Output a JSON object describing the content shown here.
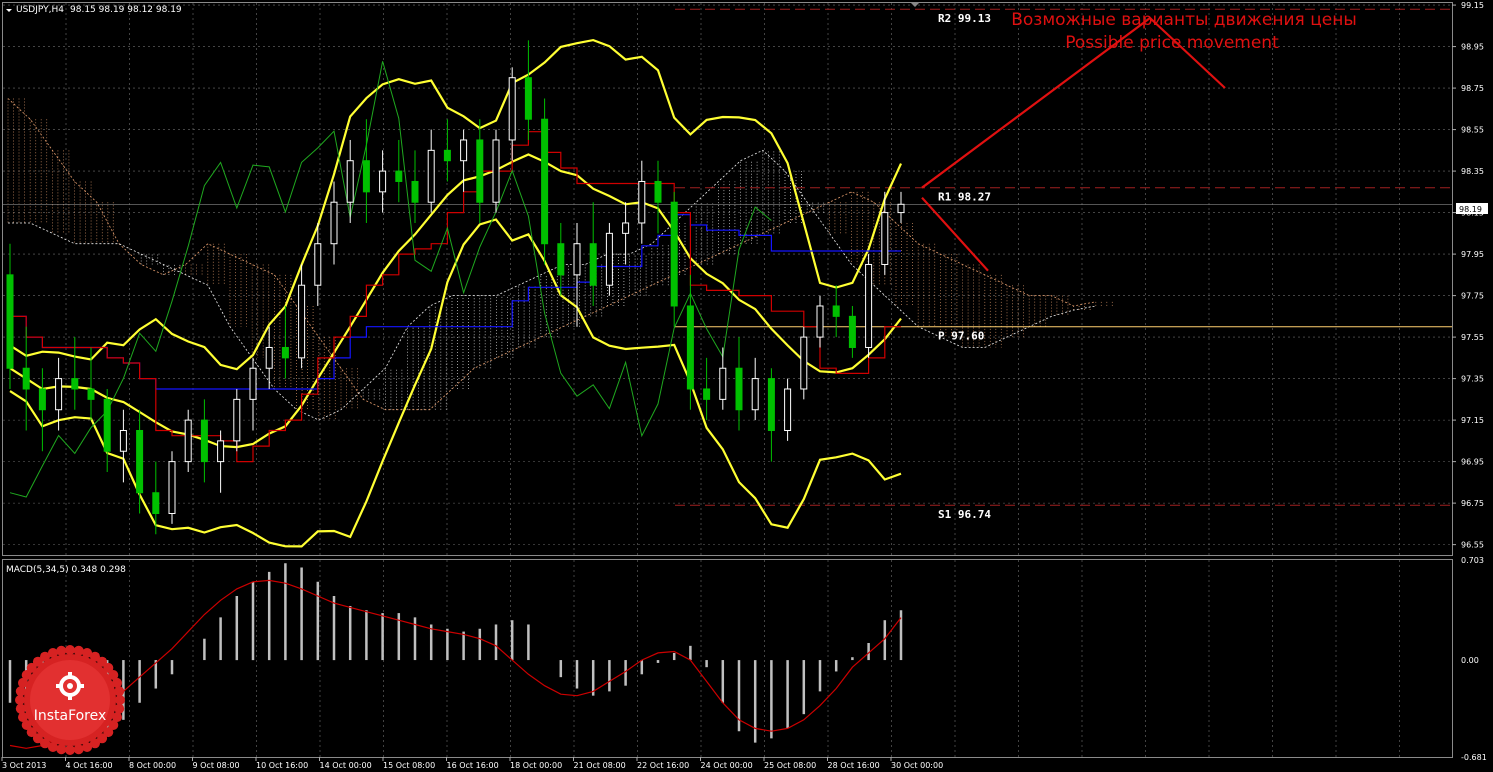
{
  "header": {
    "symbol": "USDJPY,H4",
    "ohlc": "98.15 98.19 98.12 98.19"
  },
  "macd_header": "MACD(5,34,5) 0.348 0.298",
  "annotation": {
    "ru": "Возможные варианты движения цены",
    "en": "Possible price movement"
  },
  "logo_text": "InstaForex",
  "colors": {
    "background": "#000000",
    "grid": "#6e6e6e",
    "bull": "#ffffff",
    "bear": "#00c000",
    "tenkan": "#d00000",
    "kijun": "#1414ff",
    "chikou": "#1fa81f",
    "bollinger": "#ffff33",
    "cloud_a": "#e8a070",
    "cloud_b": "#f0f0f0",
    "pivot": "#ffd070",
    "levels": "#a02020",
    "annotation": "#e01010",
    "macd_hist": "#c0c0c0",
    "macd_signal": "#cc0000"
  },
  "chart_data": {
    "type": "candlestick",
    "symbol": "USDJPY",
    "timeframe": "H4",
    "ylim": [
      96.5,
      99.16
    ],
    "y_ticks": [
      "99.15",
      "98.95",
      "98.75",
      "98.55",
      "98.35",
      "98.15",
      "97.95",
      "97.75",
      "97.55",
      "97.35",
      "97.15",
      "96.95",
      "96.75",
      "96.55"
    ],
    "current_price": "98.19",
    "x_ticks": [
      "3 Oct 2013",
      "4 Oct 16:00",
      "8 Oct 00:00",
      "9 Oct 08:00",
      "10 Oct 16:00",
      "14 Oct 00:00",
      "15 Oct 08:00",
      "16 Oct 16:00",
      "18 Oct 00:00",
      "21 Oct 08:00",
      "22 Oct 16:00",
      "24 Oct 00:00",
      "25 Oct 08:00",
      "28 Oct 16:00",
      "30 Oct 00:00"
    ],
    "levels": [
      {
        "label": "R2 99.13",
        "value": 99.13
      },
      {
        "label": "R1 98.27",
        "value": 98.27
      },
      {
        "label": "P 97.60",
        "value": 97.6
      },
      {
        "label": "S1 96.74",
        "value": 96.74
      }
    ],
    "candles": [
      {
        "o": 97.85,
        "h": 98.0,
        "l": 97.3,
        "c": 97.4
      },
      {
        "o": 97.4,
        "h": 97.6,
        "l": 97.1,
        "c": 97.3
      },
      {
        "o": 97.3,
        "h": 97.4,
        "l": 97.0,
        "c": 97.2
      },
      {
        "o": 97.2,
        "h": 97.45,
        "l": 97.1,
        "c": 97.35
      },
      {
        "o": 97.35,
        "h": 97.55,
        "l": 97.2,
        "c": 97.3
      },
      {
        "o": 97.3,
        "h": 97.5,
        "l": 97.15,
        "c": 97.25
      },
      {
        "o": 97.25,
        "h": 97.3,
        "l": 96.9,
        "c": 97.0
      },
      {
        "o": 97.0,
        "h": 97.2,
        "l": 96.85,
        "c": 97.1
      },
      {
        "o": 97.1,
        "h": 97.2,
        "l": 96.7,
        "c": 96.8
      },
      {
        "o": 96.8,
        "h": 96.95,
        "l": 96.6,
        "c": 96.7
      },
      {
        "o": 96.7,
        "h": 97.0,
        "l": 96.65,
        "c": 96.95
      },
      {
        "o": 96.95,
        "h": 97.2,
        "l": 96.9,
        "c": 97.15
      },
      {
        "o": 97.15,
        "h": 97.25,
        "l": 96.85,
        "c": 96.95
      },
      {
        "o": 96.95,
        "h": 97.1,
        "l": 96.8,
        "c": 97.05
      },
      {
        "o": 97.05,
        "h": 97.3,
        "l": 97.0,
        "c": 97.25
      },
      {
        "o": 97.25,
        "h": 97.45,
        "l": 97.1,
        "c": 97.4
      },
      {
        "o": 97.4,
        "h": 97.6,
        "l": 97.3,
        "c": 97.5
      },
      {
        "o": 97.5,
        "h": 97.7,
        "l": 97.35,
        "c": 97.45
      },
      {
        "o": 97.45,
        "h": 97.9,
        "l": 97.4,
        "c": 97.8
      },
      {
        "o": 97.8,
        "h": 98.1,
        "l": 97.7,
        "c": 98.0
      },
      {
        "o": 98.0,
        "h": 98.3,
        "l": 97.9,
        "c": 98.2
      },
      {
        "o": 98.2,
        "h": 98.5,
        "l": 98.1,
        "c": 98.4
      },
      {
        "o": 98.4,
        "h": 98.6,
        "l": 98.1,
        "c": 98.25
      },
      {
        "o": 98.25,
        "h": 98.45,
        "l": 98.15,
        "c": 98.35
      },
      {
        "o": 98.35,
        "h": 98.5,
        "l": 98.2,
        "c": 98.3
      },
      {
        "o": 98.3,
        "h": 98.45,
        "l": 98.1,
        "c": 98.2
      },
      {
        "o": 98.2,
        "h": 98.55,
        "l": 98.15,
        "c": 98.45
      },
      {
        "o": 98.45,
        "h": 98.6,
        "l": 98.3,
        "c": 98.4
      },
      {
        "o": 98.4,
        "h": 98.55,
        "l": 98.25,
        "c": 98.5
      },
      {
        "o": 98.5,
        "h": 98.6,
        "l": 98.1,
        "c": 98.2
      },
      {
        "o": 98.2,
        "h": 98.55,
        "l": 98.15,
        "c": 98.5
      },
      {
        "o": 98.5,
        "h": 98.85,
        "l": 98.4,
        "c": 98.8
      },
      {
        "o": 98.8,
        "h": 98.98,
        "l": 98.5,
        "c": 98.6
      },
      {
        "o": 98.6,
        "h": 98.7,
        "l": 97.9,
        "c": 98.0
      },
      {
        "o": 98.0,
        "h": 98.1,
        "l": 97.75,
        "c": 97.85
      },
      {
        "o": 97.85,
        "h": 98.1,
        "l": 97.6,
        "c": 98.0
      },
      {
        "o": 98.0,
        "h": 98.2,
        "l": 97.7,
        "c": 97.8
      },
      {
        "o": 97.8,
        "h": 98.1,
        "l": 97.75,
        "c": 98.05
      },
      {
        "o": 98.05,
        "h": 98.2,
        "l": 97.9,
        "c": 98.1
      },
      {
        "o": 98.1,
        "h": 98.4,
        "l": 98.0,
        "c": 98.3
      },
      {
        "o": 98.3,
        "h": 98.4,
        "l": 98.05,
        "c": 98.2
      },
      {
        "o": 98.2,
        "h": 98.25,
        "l": 97.6,
        "c": 97.7
      },
      {
        "o": 97.7,
        "h": 97.85,
        "l": 97.2,
        "c": 97.3
      },
      {
        "o": 97.3,
        "h": 97.45,
        "l": 97.15,
        "c": 97.25
      },
      {
        "o": 97.25,
        "h": 97.5,
        "l": 97.2,
        "c": 97.4
      },
      {
        "o": 97.4,
        "h": 97.55,
        "l": 97.1,
        "c": 97.2
      },
      {
        "o": 97.2,
        "h": 97.45,
        "l": 97.15,
        "c": 97.35
      },
      {
        "o": 97.35,
        "h": 97.4,
        "l": 96.95,
        "c": 97.1
      },
      {
        "o": 97.1,
        "h": 97.35,
        "l": 97.05,
        "c": 97.3
      },
      {
        "o": 97.3,
        "h": 97.6,
        "l": 97.25,
        "c": 97.55
      },
      {
        "o": 97.55,
        "h": 97.75,
        "l": 97.5,
        "c": 97.7
      },
      {
        "o": 97.7,
        "h": 97.8,
        "l": 97.55,
        "c": 97.65
      },
      {
        "o": 97.65,
        "h": 97.7,
        "l": 97.45,
        "c": 97.5
      },
      {
        "o": 97.5,
        "h": 97.95,
        "l": 97.45,
        "c": 97.9
      },
      {
        "o": 97.9,
        "h": 98.25,
        "l": 97.85,
        "c": 98.15
      },
      {
        "o": 98.15,
        "h": 98.25,
        "l": 98.1,
        "c": 98.19
      }
    ],
    "macd": {
      "params": "5,34,5",
      "main": 0.348,
      "signal": 0.298,
      "ylim": [
        -0.681,
        0.703
      ],
      "y_ticks": [
        "0.703",
        "0.00",
        "-0.681"
      ],
      "histogram": [
        -0.3,
        -0.36,
        -0.42,
        -0.48,
        -0.52,
        -0.55,
        -0.5,
        -0.42,
        -0.3,
        -0.2,
        -0.1,
        0.0,
        0.15,
        0.3,
        0.45,
        0.55,
        0.62,
        0.68,
        0.65,
        0.55,
        0.45,
        0.38,
        0.35,
        0.33,
        0.33,
        0.3,
        0.25,
        0.22,
        0.2,
        0.22,
        0.25,
        0.28,
        0.25,
        0.0,
        -0.12,
        -0.2,
        -0.25,
        -0.22,
        -0.18,
        -0.1,
        -0.02,
        0.05,
        0.1,
        -0.05,
        -0.3,
        -0.5,
        -0.58,
        -0.55,
        -0.48,
        -0.38,
        -0.22,
        -0.08,
        0.02,
        0.12,
        0.28,
        0.35
      ],
      "signal_line": [
        -0.6,
        -0.62,
        -0.6,
        -0.55,
        -0.48,
        -0.4,
        -0.32,
        -0.22,
        -0.12,
        -0.02,
        0.08,
        0.2,
        0.32,
        0.42,
        0.5,
        0.55,
        0.56,
        0.54,
        0.5,
        0.45,
        0.4,
        0.37,
        0.34,
        0.31,
        0.28,
        0.25,
        0.22,
        0.2,
        0.18,
        0.15,
        0.1,
        0.0,
        -0.1,
        -0.18,
        -0.24,
        -0.25,
        -0.22,
        -0.15,
        -0.08,
        0.0,
        0.05,
        0.06,
        0.0,
        -0.15,
        -0.3,
        -0.42,
        -0.48,
        -0.5,
        -0.48,
        -0.42,
        -0.32,
        -0.2,
        -0.05,
        0.05,
        0.15,
        0.298
      ]
    }
  }
}
